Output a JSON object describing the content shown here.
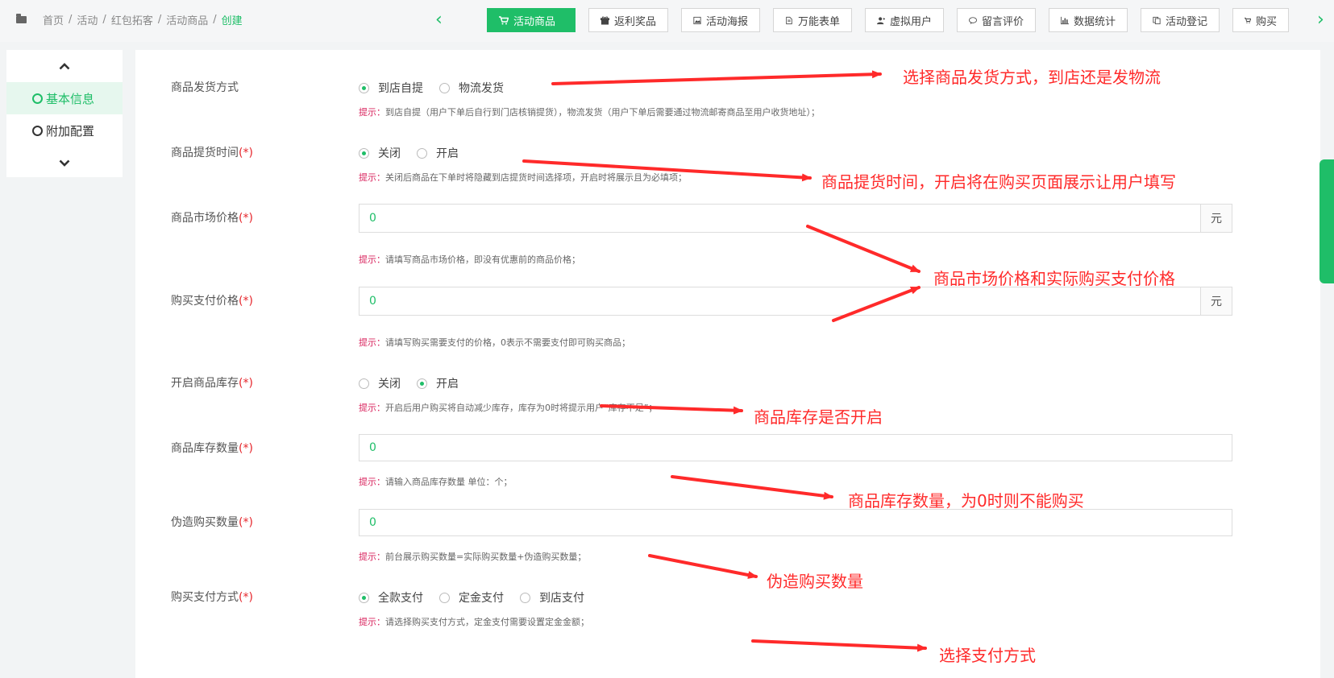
{
  "breadcrumb": {
    "items": [
      "首页",
      "活动",
      "红包拓客",
      "活动商品"
    ],
    "current": "创建"
  },
  "toolbar": {
    "tabs": [
      {
        "label": "活动商品",
        "icon": "cart-icon",
        "active": true
      },
      {
        "label": "返利奖品",
        "icon": "gift-icon"
      },
      {
        "label": "活动海报",
        "icon": "image-icon"
      },
      {
        "label": "万能表单",
        "icon": "document-icon"
      },
      {
        "label": "虚拟用户",
        "icon": "user-add-icon"
      },
      {
        "label": "留言评价",
        "icon": "comment-icon"
      },
      {
        "label": "数据统计",
        "icon": "bar-chart-icon"
      },
      {
        "label": "活动登记",
        "icon": "copy-icon"
      },
      {
        "label": "购买",
        "icon": "cart-icon"
      }
    ]
  },
  "sidebar": {
    "items": [
      {
        "label": "基本信息",
        "active": true
      },
      {
        "label": "附加配置"
      }
    ]
  },
  "tip_prefix": "提示：",
  "required_mark": "(*)",
  "form": {
    "delivery": {
      "label": "商品发货方式",
      "options": [
        "到店自提",
        "物流发货"
      ],
      "selected": "到店自提",
      "tip": "到店自提（用户下单后自行到门店核销提货），物流发货（用户下单后需要通过物流邮寄商品至用户收货地址）；"
    },
    "pickup_time": {
      "label": "商品提货时间",
      "options": [
        "关闭",
        "开启"
      ],
      "selected": "关闭",
      "tip": "关闭后商品在下单时将隐藏到店提货时间选择项，开启时将展示且为必填项；"
    },
    "market_price": {
      "label": "商品市场价格",
      "value": "0",
      "unit": "元",
      "tip": "请填写商品市场价格，即没有优惠前的商品价格；"
    },
    "pay_price": {
      "label": "购买支付价格",
      "value": "0",
      "unit": "元",
      "tip": "请填写购买需要支付的价格，0表示不需要支付即可购买商品；"
    },
    "stock_enable": {
      "label": "开启商品库存",
      "options": [
        "关闭",
        "开启"
      ],
      "selected": "开启",
      "tip": "开启后用户购买将自动减少库存，库存为0时将提示用户“库存不足”；"
    },
    "stock_qty": {
      "label": "商品库存数量",
      "value": "0",
      "tip": "请输入商品库存数量 单位：个；"
    },
    "fake_qty": {
      "label": "伪造购买数量",
      "value": "0",
      "tip": "前台展示购买数量=实际购买数量+伪造购买数量；"
    },
    "pay_method": {
      "label": "购买支付方式",
      "options": [
        "全款支付",
        "定金支付",
        "到店支付"
      ],
      "selected": "全款支付",
      "tip": "请选择购买支付方式，定金支付需要设置定金金额；"
    }
  },
  "annotations": {
    "delivery": "选择商品发货方式，到店还是发物流",
    "pickup_time": "商品提货时间，开启将在购买页面展示让用户填写",
    "prices": "商品市场价格和实际购买支付价格",
    "stock_enable": "商品库存是否开启",
    "stock_qty": "商品库存数量，为0时则不能购买",
    "fake_qty": "伪造购买数量",
    "pay_method": "选择支付方式"
  },
  "colors": {
    "accent": "#1fbe68",
    "annotation": "#ff2a2a",
    "tip_prefix": "#d9245e",
    "required": "#e6262c"
  }
}
